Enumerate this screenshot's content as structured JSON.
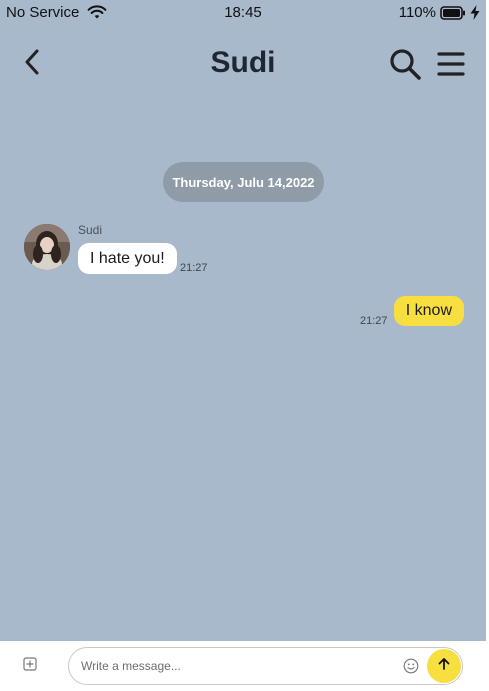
{
  "status_bar": {
    "carrier": "No Service",
    "time": "18:45",
    "battery": "110%",
    "icons": [
      "wifi-icon",
      "battery-icon",
      "bolt-icon"
    ]
  },
  "header": {
    "title": "Sudi",
    "icons": [
      "chevron-left-icon",
      "search-icon",
      "menu-icon"
    ]
  },
  "chat": {
    "date_label": "Thursday, Julu 14,2022",
    "messages": [
      {
        "direction": "incoming",
        "sender": "Sudi",
        "text": "I hate you!",
        "time": "21:27"
      },
      {
        "direction": "outgoing",
        "text": "I know",
        "time": "21:27"
      }
    ]
  },
  "composer": {
    "placeholder": "Write a message...",
    "value": "",
    "icons": [
      "add-box-icon",
      "emoji-icon",
      "arrow-up-icon"
    ]
  },
  "colors": {
    "background": "#a8b9cb",
    "date_pill": "#8f9ba6",
    "outgoing_bubble": "#f7df3f",
    "incoming_bubble": "#ffffff",
    "send_button": "#f7df3f"
  }
}
